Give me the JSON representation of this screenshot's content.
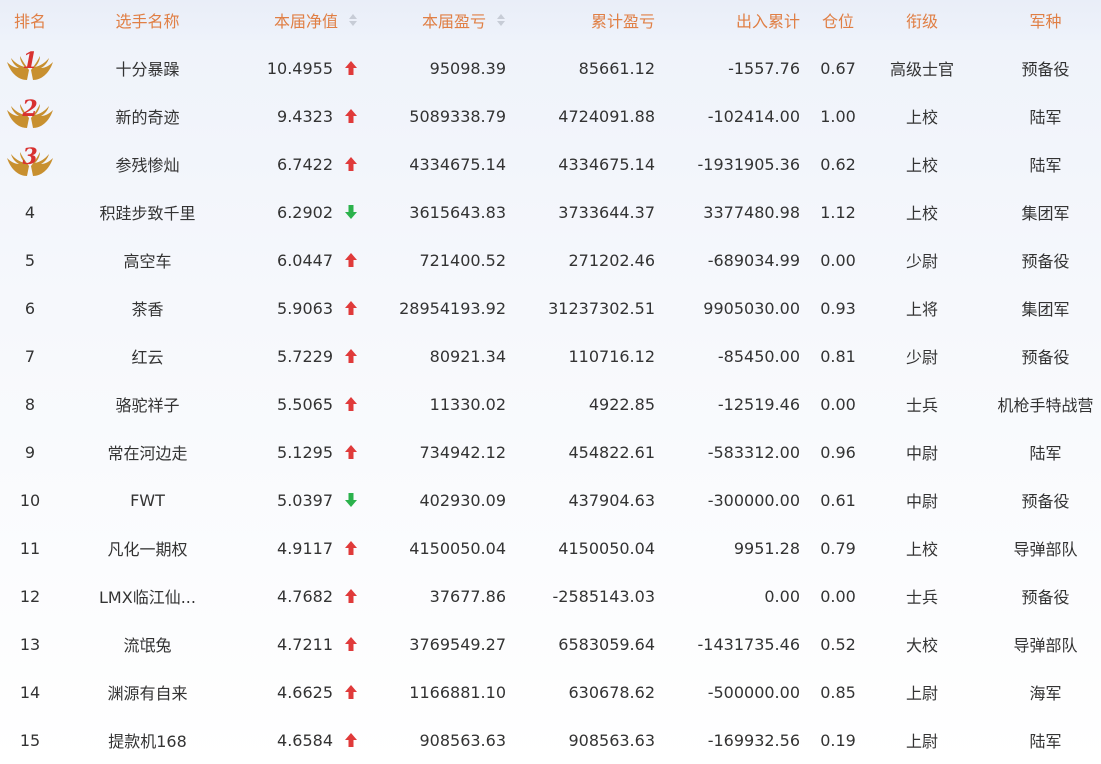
{
  "colors": {
    "header_text": "#e07f45",
    "up_arrow": "#e03a3a",
    "down_arrow": "#2bb24c",
    "medal_gold": "#c8902f",
    "medal_number": "#d8312f"
  },
  "header": {
    "rank": "排名",
    "name": "选手名称",
    "nav": "本届净值",
    "pl": "本届盈亏",
    "cum": "累计盈亏",
    "io": "出入累计",
    "pos": "仓位",
    "grade": "衔级",
    "army": "军种"
  },
  "rows": [
    {
      "rank": "1",
      "medal": true,
      "name": "十分暴躁",
      "nav": "10.4955",
      "dir": "up",
      "pl": "95098.39",
      "cum": "85661.12",
      "io": "-1557.76",
      "pos": "0.67",
      "grade": "高级士官",
      "army": "预备役"
    },
    {
      "rank": "2",
      "medal": true,
      "name": "新的奇迹",
      "nav": "9.4323",
      "dir": "up",
      "pl": "5089338.79",
      "cum": "4724091.88",
      "io": "-102414.00",
      "pos": "1.00",
      "grade": "上校",
      "army": "陆军"
    },
    {
      "rank": "3",
      "medal": true,
      "name": "参残惨灿",
      "nav": "6.7422",
      "dir": "up",
      "pl": "4334675.14",
      "cum": "4334675.14",
      "io": "-1931905.36",
      "pos": "0.62",
      "grade": "上校",
      "army": "陆军"
    },
    {
      "rank": "4",
      "medal": false,
      "name": "积跬步致千里",
      "nav": "6.2902",
      "dir": "down",
      "pl": "3615643.83",
      "cum": "3733644.37",
      "io": "3377480.98",
      "pos": "1.12",
      "grade": "上校",
      "army": "集团军"
    },
    {
      "rank": "5",
      "medal": false,
      "name": "高空车",
      "nav": "6.0447",
      "dir": "up",
      "pl": "721400.52",
      "cum": "271202.46",
      "io": "-689034.99",
      "pos": "0.00",
      "grade": "少尉",
      "army": "预备役"
    },
    {
      "rank": "6",
      "medal": false,
      "name": "茶香",
      "nav": "5.9063",
      "dir": "up",
      "pl": "28954193.92",
      "cum": "31237302.51",
      "io": "9905030.00",
      "pos": "0.93",
      "grade": "上将",
      "army": "集团军"
    },
    {
      "rank": "7",
      "medal": false,
      "name": "红云",
      "nav": "5.7229",
      "dir": "up",
      "pl": "80921.34",
      "cum": "110716.12",
      "io": "-85450.00",
      "pos": "0.81",
      "grade": "少尉",
      "army": "预备役"
    },
    {
      "rank": "8",
      "medal": false,
      "name": "骆驼祥子",
      "nav": "5.5065",
      "dir": "up",
      "pl": "11330.02",
      "cum": "4922.85",
      "io": "-12519.46",
      "pos": "0.00",
      "grade": "士兵",
      "army": "机枪手特战营"
    },
    {
      "rank": "9",
      "medal": false,
      "name": "常在河边走",
      "nav": "5.1295",
      "dir": "up",
      "pl": "734942.12",
      "cum": "454822.61",
      "io": "-583312.00",
      "pos": "0.96",
      "grade": "中尉",
      "army": "陆军"
    },
    {
      "rank": "10",
      "medal": false,
      "name": "FWT",
      "nav": "5.0397",
      "dir": "down",
      "pl": "402930.09",
      "cum": "437904.63",
      "io": "-300000.00",
      "pos": "0.61",
      "grade": "中尉",
      "army": "预备役"
    },
    {
      "rank": "11",
      "medal": false,
      "name": "凡化一期权",
      "nav": "4.9117",
      "dir": "up",
      "pl": "4150050.04",
      "cum": "4150050.04",
      "io": "9951.28",
      "pos": "0.79",
      "grade": "上校",
      "army": "导弹部队"
    },
    {
      "rank": "12",
      "medal": false,
      "name": "LMX临江仙...",
      "nav": "4.7682",
      "dir": "up",
      "pl": "37677.86",
      "cum": "-2585143.03",
      "io": "0.00",
      "pos": "0.00",
      "grade": "士兵",
      "army": "预备役"
    },
    {
      "rank": "13",
      "medal": false,
      "name": "流氓兔",
      "nav": "4.7211",
      "dir": "up",
      "pl": "3769549.27",
      "cum": "6583059.64",
      "io": "-1431735.46",
      "pos": "0.52",
      "grade": "大校",
      "army": "导弹部队"
    },
    {
      "rank": "14",
      "medal": false,
      "name": "渊源有自来",
      "nav": "4.6625",
      "dir": "up",
      "pl": "1166881.10",
      "cum": "630678.62",
      "io": "-500000.00",
      "pos": "0.85",
      "grade": "上尉",
      "army": "海军"
    },
    {
      "rank": "15",
      "medal": false,
      "name": "提款机168",
      "nav": "4.6584",
      "dir": "up",
      "pl": "908563.63",
      "cum": "908563.63",
      "io": "-169932.56",
      "pos": "0.19",
      "grade": "上尉",
      "army": "陆军"
    }
  ]
}
